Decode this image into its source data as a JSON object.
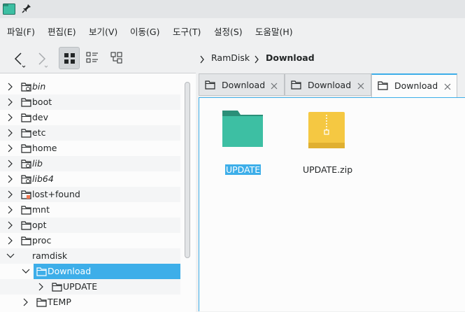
{
  "colors": {
    "accent": "#3daee9",
    "folder_teal": "#3dbfa3",
    "zip_yellow": "#f5c842"
  },
  "menu": [
    "파일(F)",
    "편집(E)",
    "보기(V)",
    "이동(G)",
    "도구(T)",
    "설정(S)",
    "도움말(H)"
  ],
  "breadcrumb": {
    "items": [
      "RamDisk",
      "Download"
    ]
  },
  "tree": {
    "items": [
      {
        "label": "bin",
        "italic": true,
        "icon": "folder-link-icon"
      },
      {
        "label": "boot",
        "italic": false,
        "icon": "folder-icon"
      },
      {
        "label": "dev",
        "italic": false,
        "icon": "folder-icon"
      },
      {
        "label": "etc",
        "italic": false,
        "icon": "folder-icon"
      },
      {
        "label": "home",
        "italic": false,
        "icon": "folder-icon"
      },
      {
        "label": "lib",
        "italic": true,
        "icon": "folder-link-icon"
      },
      {
        "label": "lib64",
        "italic": true,
        "icon": "folder-link-icon"
      },
      {
        "label": "lost+found",
        "italic": false,
        "icon": "folder-locked-icon"
      },
      {
        "label": "mnt",
        "italic": false,
        "icon": "folder-icon"
      },
      {
        "label": "opt",
        "italic": false,
        "icon": "folder-icon"
      },
      {
        "label": "proc",
        "italic": false,
        "icon": "folder-icon"
      },
      {
        "label": "ramdisk",
        "italic": false,
        "icon": "none",
        "expanded": true
      },
      {
        "label": "Download",
        "italic": false,
        "icon": "folder-icon",
        "expanded": true,
        "selected": true
      },
      {
        "label": "UPDATE",
        "italic": false,
        "icon": "folder-icon"
      },
      {
        "label": "TEMP",
        "italic": false,
        "icon": "folder-icon"
      }
    ]
  },
  "tabs": [
    {
      "label": "Download",
      "active": false
    },
    {
      "label": "Download",
      "active": false
    },
    {
      "label": "Download",
      "active": true
    }
  ],
  "files": [
    {
      "name": "UPDATE",
      "type": "folder",
      "selected": true
    },
    {
      "name": "UPDATE.zip",
      "type": "zip",
      "selected": false
    }
  ]
}
